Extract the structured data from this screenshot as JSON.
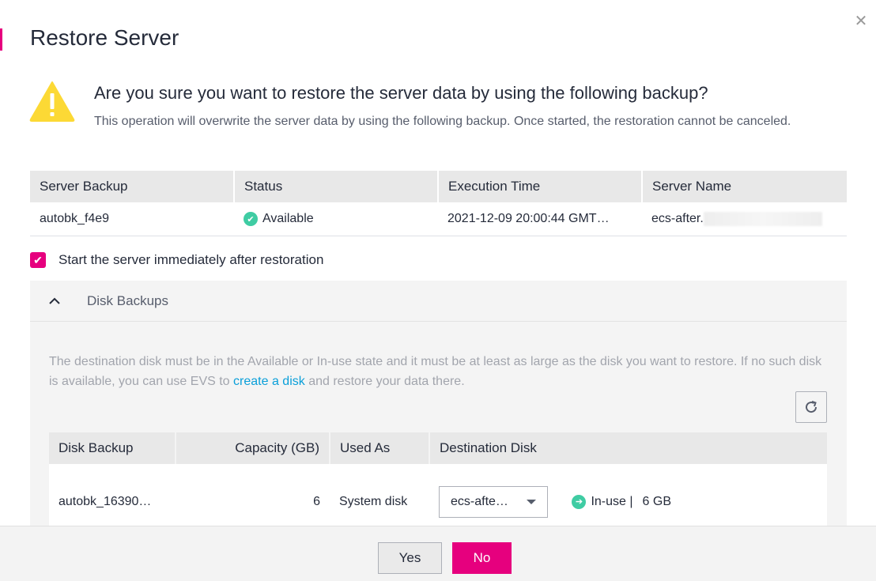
{
  "dialog": {
    "title": "Restore Server",
    "close_icon": "close-icon",
    "accent_color": "#e6007e"
  },
  "warning": {
    "icon": "warning-icon",
    "title": "Are you sure you want to restore the server data by using the following backup?",
    "description": "This operation will overwrite the server data by using the following backup. Once started, the restoration cannot be canceled."
  },
  "backup_table": {
    "headers": [
      "Server Backup",
      "Status",
      "Execution Time",
      "Server Name"
    ],
    "rows": [
      {
        "server_backup": "autobk_f4e9",
        "status": "Available",
        "execution_time": "2021-12-09 20:00:44 GMT…",
        "server_name": "ecs-after."
      }
    ]
  },
  "start_after_restore": {
    "label": "Start the server immediately after restoration",
    "checked": true
  },
  "disk_backups": {
    "section_label": "Disk Backups",
    "expanded": true,
    "note_before_link": "The destination disk must be in the Available or In-use state and it must be at least as large as the disk you want to restore. If no such disk is available, you can use EVS to ",
    "link_text": "create a disk",
    "note_after_link": " and restore your data there.",
    "refresh_icon": "refresh-icon",
    "headers": [
      "Disk Backup",
      "Capacity (GB)",
      "Used As",
      "Destination Disk"
    ],
    "rows": [
      {
        "disk_backup": "autobk_16390…",
        "capacity": "6",
        "used_as": "System disk",
        "destination_disk": "ecs-afte…",
        "disk_status": "In-use |",
        "disk_size": "6 GB"
      }
    ]
  },
  "footer": {
    "yes_label": "Yes",
    "no_label": "No"
  }
}
